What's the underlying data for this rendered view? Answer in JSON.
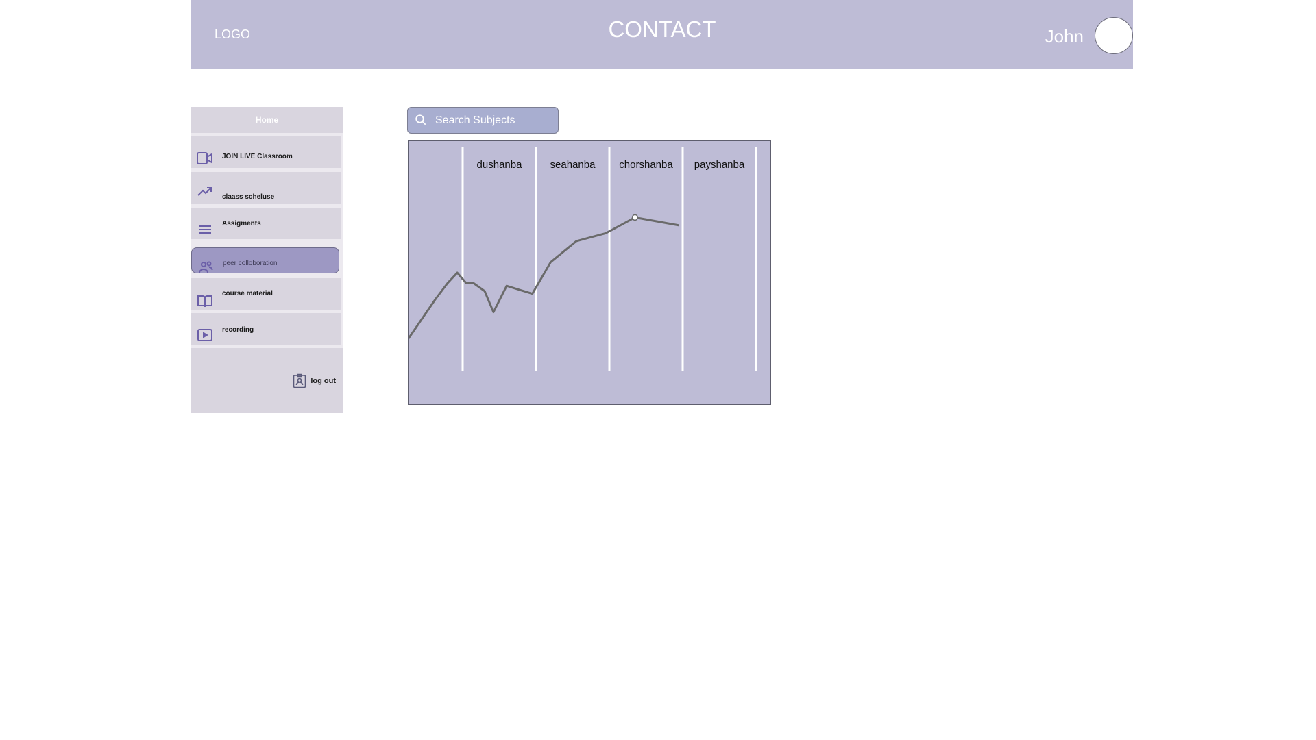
{
  "header": {
    "logo": "LOGO",
    "title": "CONTACT",
    "user_name": "John"
  },
  "sidebar": {
    "home_label": "Home",
    "items": [
      {
        "label": "JOIN LIVE Classroom",
        "icon": "video-camera-icon"
      },
      {
        "label": "claass scheluse",
        "icon": "trending-up-icon"
      },
      {
        "label": "Assigments",
        "icon": "menu-lines-icon"
      },
      {
        "label": "peer colloboration",
        "icon": "people-icon",
        "active": true
      },
      {
        "label": "course material",
        "icon": "open-book-icon"
      },
      {
        "label": "recording",
        "icon": "play-icon"
      }
    ],
    "logout_label": "log out"
  },
  "search": {
    "placeholder": "Search Subjects"
  },
  "colors": {
    "header_bg": "#bebcd6",
    "sidebar_bg": "#d9d5df",
    "active_item_bg": "#9d98c3",
    "icon_color": "#6b5fa8",
    "chart_bg": "#bebcd6",
    "line_color": "#6a6a6a"
  },
  "chart_data": {
    "type": "line",
    "categories": [
      "dushanba",
      "seahanba",
      "chorshanba",
      "payshanba"
    ],
    "grid": true,
    "series": [
      {
        "points": [
          [
            0.0,
            0.25
          ],
          [
            0.5,
            0.4
          ],
          [
            0.72,
            0.46
          ],
          [
            0.9,
            0.5
          ],
          [
            1.05,
            0.46
          ],
          [
            1.15,
            0.46
          ],
          [
            1.3,
            0.43
          ],
          [
            1.42,
            0.35
          ],
          [
            1.6,
            0.45
          ],
          [
            1.95,
            0.42
          ],
          [
            2.2,
            0.54
          ],
          [
            2.55,
            0.62
          ],
          [
            2.95,
            0.65
          ],
          [
            3.35,
            0.71
          ],
          [
            3.95,
            0.68
          ]
        ],
        "highlighted_point": [
          3.35,
          0.71
        ]
      }
    ]
  }
}
